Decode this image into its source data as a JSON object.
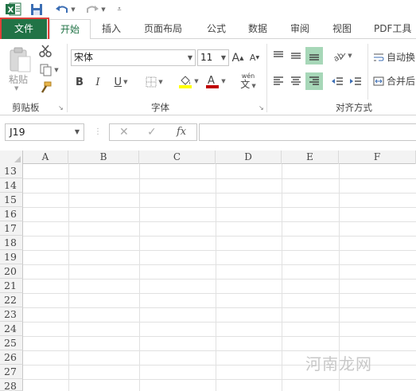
{
  "qat": {
    "icons": [
      "excel-logo-icon",
      "save-icon",
      "undo-icon",
      "redo-icon",
      "customize-qat-icon"
    ]
  },
  "tabs": {
    "file": "文件",
    "items": [
      {
        "label": "开始",
        "active": true
      },
      {
        "label": "插入",
        "active": false
      },
      {
        "label": "页面布局",
        "active": false
      },
      {
        "label": "公式",
        "active": false
      },
      {
        "label": "数据",
        "active": false
      },
      {
        "label": "审阅",
        "active": false
      },
      {
        "label": "视图",
        "active": false
      },
      {
        "label": "PDF工具",
        "active": false
      }
    ]
  },
  "ribbon": {
    "clipboard": {
      "paste_label": "粘贴",
      "group_label": "剪贴板"
    },
    "font": {
      "font_name": "宋体",
      "font_size": "11",
      "group_label": "字体",
      "bold": "B",
      "italic": "I",
      "underline": "U",
      "grow": "A",
      "shrink": "A",
      "wen": "wén",
      "wen_char": "文"
    },
    "alignment": {
      "wrap_label": "自动换",
      "merge_label": "合并后",
      "group_label": "对齐方式"
    }
  },
  "formula_bar": {
    "name_box": "J19",
    "fx": "fx",
    "value": ""
  },
  "grid": {
    "columns": [
      "A",
      "B",
      "C",
      "D",
      "E",
      "F"
    ],
    "rows": [
      "13",
      "14",
      "15",
      "16",
      "17",
      "18",
      "19",
      "20",
      "21",
      "22",
      "23",
      "24",
      "25",
      "26",
      "27",
      "28"
    ]
  },
  "watermark": "河南龙网",
  "colors": {
    "accent": "#217346",
    "highlight_box": "#e0403a",
    "font_color_bar": "#c00000",
    "fill_color_bar": "#ffff00"
  }
}
